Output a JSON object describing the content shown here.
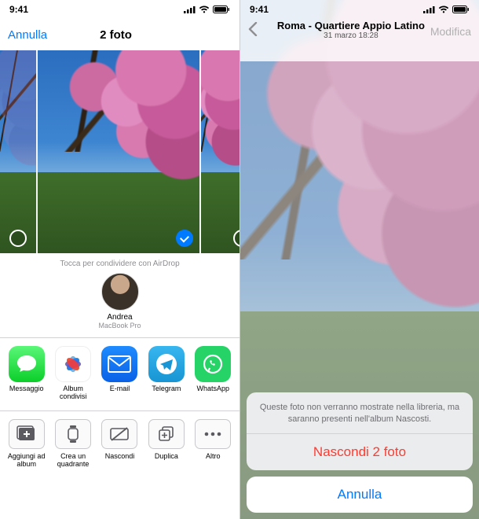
{
  "left": {
    "status_time": "9:41",
    "nav": {
      "cancel": "Annulla",
      "title": "2 foto"
    },
    "airdrop_hint": "Tocca per condividere con AirDrop",
    "contact": {
      "name": "Andrea",
      "device": "MacBook Pro"
    },
    "apps": [
      {
        "id": "messages",
        "label": "Messaggio"
      },
      {
        "id": "photos",
        "label": "Album condivisi"
      },
      {
        "id": "mail",
        "label": "E-mail"
      },
      {
        "id": "telegram",
        "label": "Telegram"
      },
      {
        "id": "whatsapp",
        "label": "WhatsApp"
      }
    ],
    "actions": [
      {
        "id": "add-album",
        "label": "Aggiungi ad album"
      },
      {
        "id": "watchface",
        "label": "Crea un quadrante"
      },
      {
        "id": "hide",
        "label": "Nascondi"
      },
      {
        "id": "duplicate",
        "label": "Duplica"
      },
      {
        "id": "more",
        "label": "Altro"
      }
    ]
  },
  "right": {
    "status_time": "9:41",
    "location": "Roma - Quartiere Appio Latino",
    "datetime": "31 marzo  18:28",
    "edit": "Modifica",
    "sheet": {
      "message": "Queste foto non verranno mostrate nella libreria, ma saranno presenti nell'album Nascosti.",
      "hide": "Nascondi 2 foto",
      "cancel": "Annulla"
    }
  }
}
